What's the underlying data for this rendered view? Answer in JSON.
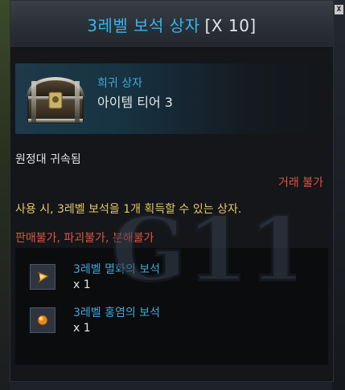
{
  "tooltip": {
    "title": "3레벨 보석 상자",
    "count": "[X 10]",
    "rarity": "희귀 상자",
    "tier": "아이템 티어 3",
    "binding": "원정대 귀속됨",
    "trade": "거래 불가",
    "description": "사용 시, 3레벨 보석을 1개 획득할 수 있는 상자.",
    "restrictions": "판매불가, 파괴불가, 분해불가"
  },
  "contents": [
    {
      "name": "3레벨 멸화의 보석",
      "qty": "x 1",
      "icon": "flame-gem-icon"
    },
    {
      "name": "3레벨 홍염의 보석",
      "qty": "x 1",
      "icon": "crimson-gem-icon"
    }
  ],
  "watermark": "G11",
  "colors": {
    "title": "#34b6ee",
    "rarity": "#3fa9d9",
    "warning": "#e0543e",
    "description": "#e5c96a"
  }
}
